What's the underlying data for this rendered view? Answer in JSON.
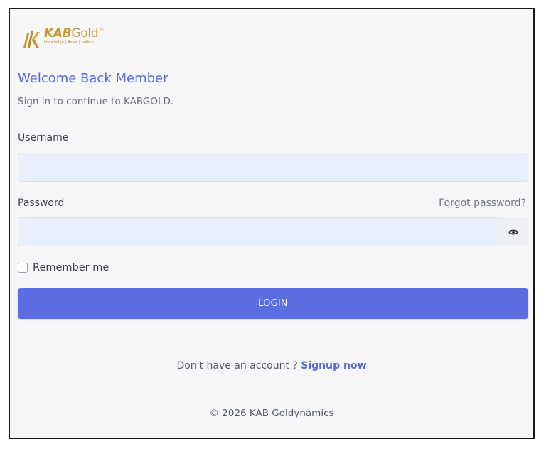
{
  "brand": {
    "name_bold": "KAB",
    "name_rest": "Gold",
    "registered_mark": "®",
    "tagline": "knowledge | Asset | bullion",
    "color": "#c59a2c"
  },
  "header": {
    "title": "Welcome Back Member",
    "subtitle": "Sign in to continue to KABGOLD."
  },
  "form": {
    "username_label": "Username",
    "username_value": "",
    "password_label": "Password",
    "password_value": "",
    "forgot_link": "Forgot password?",
    "toggle_icon": "eye-icon",
    "remember_label": "Remember me",
    "remember_checked": false,
    "login_label": "LOGIN"
  },
  "signup": {
    "prompt": "Don't have an account ?",
    "link": "Signup now"
  },
  "footer": {
    "copyright": "© 2026 KAB Goldynamics"
  },
  "colors": {
    "accent": "#5369d6",
    "button": "#5b6ee1",
    "input_bg": "#e9f0fd",
    "gold": "#c59a2c"
  }
}
